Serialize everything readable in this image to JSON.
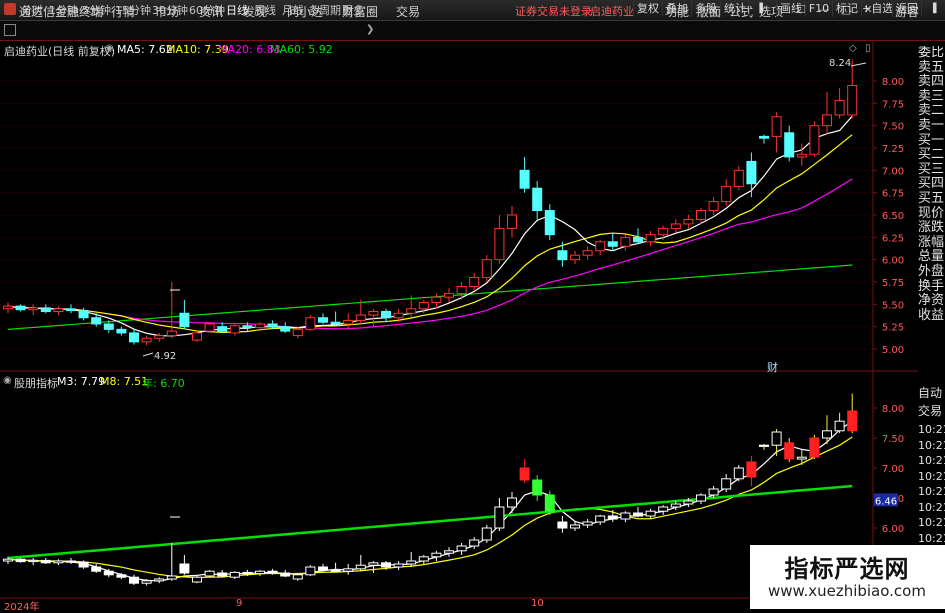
{
  "app": {
    "title": "通达信金融终端"
  },
  "menu": [
    "行情",
    "市场",
    "资讯",
    "发现",
    "问小达",
    "财富圈",
    "交易"
  ],
  "notice": "证券交易未登录",
  "current_stock": "启迪药业",
  "right_menu": [
    "功能",
    "版面",
    "公式",
    "选项"
  ],
  "guest": "游客",
  "periods": [
    "分时",
    "1分钟",
    "5分钟",
    "15分钟",
    "30分钟",
    "60分钟",
    "日线",
    "周线",
    "月线",
    "多周期",
    "更多"
  ],
  "active_period": "日线",
  "toolbar": [
    "复权",
    "叠加",
    "多股",
    "统计",
    "画线",
    "F10",
    "标记",
    "+自选",
    "返回"
  ],
  "main_legend": {
    "title": "启迪药业(日线 前复权)",
    "ma5": "MA5: 7.62",
    "ma10": "MA10: 7.39",
    "ma20": "MA20: 6.83",
    "ma60": "MA60: 5.92"
  },
  "sub_legend": {
    "name": "股朋指标",
    "m3": "M3: 7.79",
    "m8": "M8: 7.51",
    "year": "年: 6.70"
  },
  "price_axis": [
    "8.00",
    "7.75",
    "7.50",
    "7.25",
    "7.00",
    "6.75",
    "6.50",
    "6.25",
    "6.00",
    "5.75",
    "5.50",
    "5.25",
    "5.00"
  ],
  "sub_axis": [
    "8.00",
    "7.50",
    "7.00",
    "6.50",
    "6.00"
  ],
  "sub_axis_marker": "6.46",
  "high_label": "8.24",
  "low_label": "4.92",
  "fin_marker": "财",
  "date_labels": [
    "2024年",
    "9",
    "10"
  ],
  "right_panel_top": [
    "委比",
    "卖五",
    "卖四",
    "卖三",
    "卖二",
    "卖一",
    "买一",
    "买二",
    "买三",
    "买四",
    "买五",
    "现价",
    "涨跌",
    "涨幅",
    "总量",
    "外盘",
    "换手",
    "净资",
    "收益"
  ],
  "right_panel_bottom_title": [
    "自动",
    "交易"
  ],
  "right_panel_times": [
    "10:21",
    "10:21",
    "10:21",
    "10:21",
    "10:21",
    "10:21",
    "10:21",
    "10:21",
    "10:21",
    "10:21"
  ],
  "colors": {
    "up": "#ff3232",
    "down": "#54ffff",
    "ma5": "#ffffff",
    "ma10": "#ffff00",
    "ma20": "#ff00ff",
    "ma60": "#00e000",
    "grid_red": "#7a1010"
  },
  "watermark": {
    "big": "指标严选网",
    "small": "www.xuezhibiao.com"
  },
  "chart_data": {
    "type": "candlestick",
    "price_range": [
      4.92,
      8.24
    ],
    "candles": [
      [
        5.45,
        5.52,
        5.4,
        5.48
      ],
      [
        5.48,
        5.5,
        5.42,
        5.44
      ],
      [
        5.44,
        5.5,
        5.38,
        5.46
      ],
      [
        5.46,
        5.5,
        5.4,
        5.42
      ],
      [
        5.42,
        5.48,
        5.38,
        5.45
      ],
      [
        5.45,
        5.5,
        5.4,
        5.43
      ],
      [
        5.43,
        5.46,
        5.32,
        5.35
      ],
      [
        5.35,
        5.4,
        5.25,
        5.28
      ],
      [
        5.28,
        5.32,
        5.18,
        5.22
      ],
      [
        5.22,
        5.25,
        5.15,
        5.18
      ],
      [
        5.18,
        5.22,
        5.05,
        5.08
      ],
      [
        5.08,
        5.15,
        5.04,
        5.12
      ],
      [
        5.12,
        5.18,
        5.08,
        5.15
      ],
      [
        5.15,
        5.75,
        5.12,
        5.2
      ],
      [
        5.4,
        5.55,
        5.22,
        5.25
      ],
      [
        5.1,
        5.2,
        5.08,
        5.18
      ],
      [
        5.2,
        5.3,
        5.18,
        5.28
      ],
      [
        5.25,
        5.3,
        5.18,
        5.2
      ],
      [
        5.18,
        5.28,
        5.15,
        5.26
      ],
      [
        5.26,
        5.3,
        5.2,
        5.24
      ],
      [
        5.24,
        5.3,
        5.2,
        5.28
      ],
      [
        5.28,
        5.32,
        5.22,
        5.25
      ],
      [
        5.25,
        5.3,
        5.18,
        5.2
      ],
      [
        5.15,
        5.25,
        5.12,
        5.22
      ],
      [
        5.22,
        5.38,
        5.2,
        5.35
      ],
      [
        5.35,
        5.4,
        5.28,
        5.3
      ],
      [
        5.3,
        5.42,
        5.26,
        5.28
      ],
      [
        5.28,
        5.4,
        5.22,
        5.32
      ],
      [
        5.32,
        5.55,
        5.28,
        5.38
      ],
      [
        5.38,
        5.45,
        5.25,
        5.42
      ],
      [
        5.42,
        5.45,
        5.3,
        5.35
      ],
      [
        5.35,
        5.45,
        5.3,
        5.4
      ],
      [
        5.4,
        5.6,
        5.35,
        5.45
      ],
      [
        5.45,
        5.55,
        5.4,
        5.52
      ],
      [
        5.52,
        5.62,
        5.45,
        5.58
      ],
      [
        5.58,
        5.68,
        5.52,
        5.62
      ],
      [
        5.62,
        5.75,
        5.55,
        5.7
      ],
      [
        5.7,
        5.85,
        5.65,
        5.8
      ],
      [
        5.8,
        6.05,
        5.75,
        6.0
      ],
      [
        6.0,
        6.5,
        5.95,
        6.35
      ],
      [
        6.35,
        6.6,
        6.25,
        6.5
      ],
      [
        7.0,
        7.15,
        6.75,
        6.8
      ],
      [
        6.8,
        6.88,
        6.45,
        6.55
      ],
      [
        6.55,
        6.62,
        6.22,
        6.28
      ],
      [
        6.1,
        6.2,
        5.92,
        6.0
      ],
      [
        6.0,
        6.1,
        5.95,
        6.05
      ],
      [
        6.05,
        6.15,
        6.0,
        6.1
      ],
      [
        6.1,
        6.22,
        6.05,
        6.2
      ],
      [
        6.2,
        6.3,
        6.1,
        6.15
      ],
      [
        6.15,
        6.28,
        6.1,
        6.25
      ],
      [
        6.25,
        6.35,
        6.18,
        6.2
      ],
      [
        6.2,
        6.32,
        6.15,
        6.28
      ],
      [
        6.28,
        6.38,
        6.22,
        6.35
      ],
      [
        6.35,
        6.45,
        6.3,
        6.4
      ],
      [
        6.4,
        6.5,
        6.35,
        6.45
      ],
      [
        6.45,
        6.58,
        6.4,
        6.55
      ],
      [
        6.55,
        6.7,
        6.5,
        6.65
      ],
      [
        6.65,
        6.9,
        6.6,
        6.82
      ],
      [
        6.82,
        7.05,
        6.78,
        7.0
      ],
      [
        7.1,
        7.2,
        6.7,
        6.85
      ],
      [
        7.38,
        7.4,
        7.3,
        7.36
      ],
      [
        7.38,
        7.65,
        7.2,
        7.6
      ],
      [
        7.42,
        7.5,
        7.1,
        7.15
      ],
      [
        7.15,
        7.3,
        7.05,
        7.18
      ],
      [
        7.18,
        7.55,
        7.15,
        7.5
      ],
      [
        7.5,
        7.88,
        7.4,
        7.62
      ],
      [
        7.62,
        7.92,
        7.58,
        7.78
      ],
      [
        7.62,
        8.24,
        7.58,
        7.95
      ]
    ]
  }
}
